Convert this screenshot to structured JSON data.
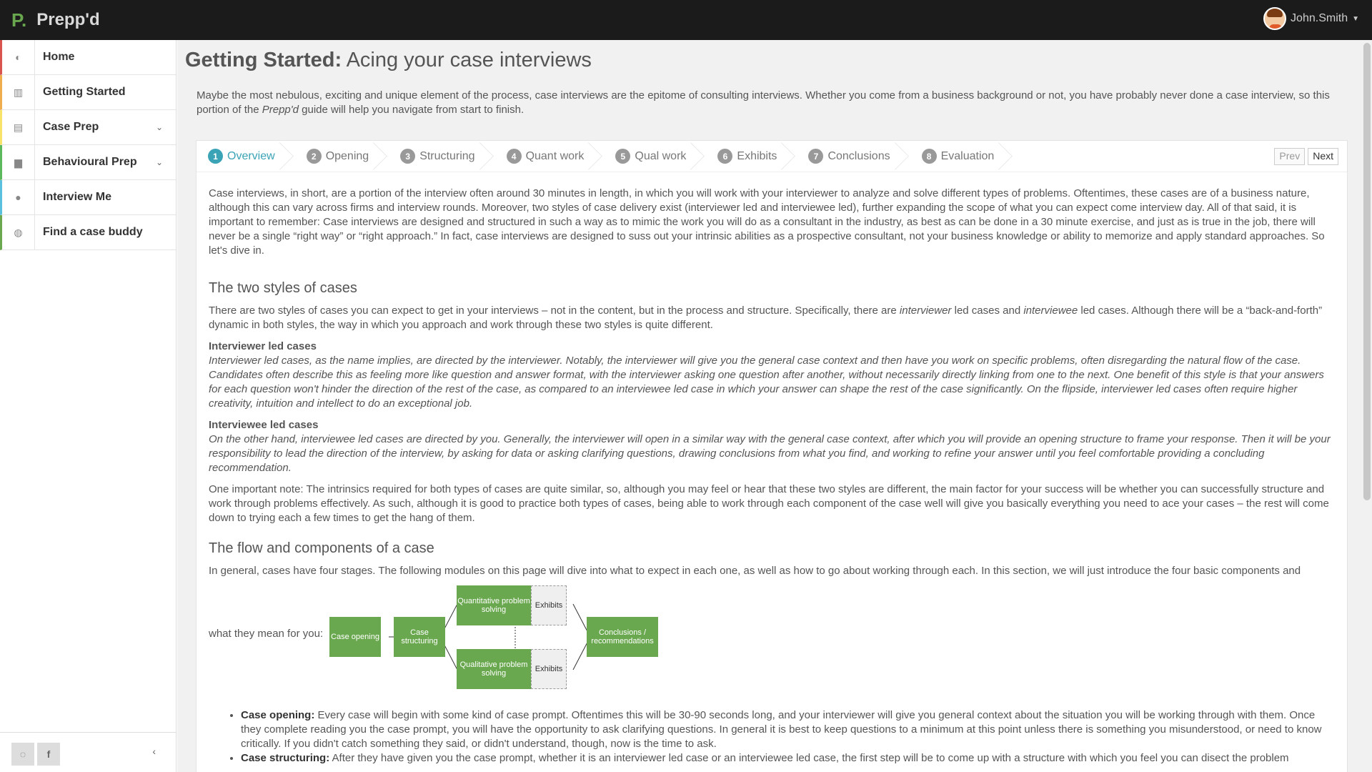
{
  "header": {
    "logo_mark": "P.",
    "app_name": "Prepp'd",
    "username": "John.Smith"
  },
  "sidebar": {
    "items": [
      {
        "label": "Home",
        "icon": "dashboard-icon"
      },
      {
        "label": "Getting Started",
        "icon": "book-open-icon"
      },
      {
        "label": "Case Prep",
        "icon": "book-icon"
      },
      {
        "label": "Behavioural Prep",
        "icon": "file-icon"
      },
      {
        "label": "Interview Me",
        "icon": "user-icon"
      },
      {
        "label": "Find a case buddy",
        "icon": "globe-icon"
      }
    ]
  },
  "page": {
    "title_bold": "Getting Started:",
    "title_rest": " Acing your case interviews",
    "intro_a": "Maybe the most nebulous, exciting and unique element of the process, case interviews are the epitome of consulting interviews. Whether you come from a business background or not, you have probably never done a case interview, so this portion of the ",
    "intro_em": "Prepp'd",
    "intro_b": " guide will help you navigate from start to finish."
  },
  "tabs": [
    {
      "num": "1",
      "label": "Overview"
    },
    {
      "num": "2",
      "label": "Opening"
    },
    {
      "num": "3",
      "label": "Structuring"
    },
    {
      "num": "4",
      "label": "Quant work"
    },
    {
      "num": "5",
      "label": "Qual work"
    },
    {
      "num": "6",
      "label": "Exhibits"
    },
    {
      "num": "7",
      "label": "Conclusions"
    },
    {
      "num": "8",
      "label": "Evaluation"
    }
  ],
  "pager": {
    "prev": "Prev",
    "next": "Next"
  },
  "content": {
    "p1": "Case interviews, in short, are a portion of the interview often around 30 minutes in length, in which you will work with your interviewer to analyze and solve different types of problems. Oftentimes, these cases are of a business nature, although this can vary across firms and interview rounds. Moreover, two styles of case delivery exist (interviewer led and interviewee led), further expanding the scope of what you can expect come interview day. All of that said, it is important to remember: Case interviews are designed and structured in such a way as to mimic the work you will do as a consultant in the industry, as best as can be done in a 30 minute exercise, and just as is true in the job, there will never be a single “right way” or “right approach.” In fact, case interviews are designed to suss out your intrinsic abilities as a prospective consultant, not your business knowledge or ability to memorize and apply standard approaches. So let's dive in.",
    "h_styles": "The two styles of cases",
    "p2a": "There are two styles of cases you can expect to get in your interviews – not in the content, but in the process and structure. Specifically, there are ",
    "p2_em1": "interviewer",
    "p2b": " led cases and ",
    "p2_em2": "interviewee",
    "p2c": " led cases. Although there will be a “back-and-forth” dynamic in both styles, the way in which you approach and work through these two styles is quite different.",
    "h_interviewer": "Interviewer led cases",
    "p_interviewer": "Interviewer led cases, as the name implies, are directed by the interviewer. Notably, the interviewer will give you the general case context and then have you work on specific problems, often disregarding the natural flow of the case. Candidates often describe this as feeling more like question and answer format, with the interviewer asking one question after another, without necessarily directly linking from one to the next. One benefit of this style is that your answers for each question won't hinder the direction of the rest of the case, as compared to an interviewee led case in which your answer can shape the rest of the case significantly. On the flipside, interviewer led cases often require higher creativity, intuition and intellect to do an exceptional job.",
    "h_interviewee": "Interviewee led cases",
    "p_interviewee": "On the other hand, interviewee led cases are directed by you. Generally, the interviewer will open in a similar way with the general case context, after which you will provide an opening structure to frame your response. Then it will be your responsibility to lead the direction of the interview, by asking for data or asking clarifying questions, drawing conclusions from what you find, and working to refine your answer until you feel comfortable providing a concluding recommendation.",
    "p_note": "One important note: The intrinsics required for both types of cases are quite similar, so, although you may feel or hear that these two styles are different, the main factor for your success will be whether you can successfully structure and work through problems effectively. As such, although it is good to practice both types of cases, being able to work through each component of the case well will give you basically everything you need to ace your cases – the rest will come down to trying each a few times to get the hang of them.",
    "h_flow": "The flow and components of a case",
    "p_flow": "In general, cases have four stages. The following modules on this page will dive into what to expect in each one, as well as how to go about working through each. In this section, we will just introduce the four basic components and",
    "flow_lead": "what they mean for you:",
    "bullet1_b": "Case opening:",
    "bullet1": " Every case will begin with some kind of case prompt. Oftentimes this will be 30-90 seconds long, and your interviewer will give you general context about the situation you will be working through with them. Once they complete reading you the case prompt, you will have the opportunity to ask clarifying questions. In general it is best to keep questions to a minimum at this point unless there is something you misunderstood, or need to know critically. If you didn't catch something they said, or didn't understand, though, now is the time to ask.",
    "bullet2_b": "Case structuring:",
    "bullet2": " After they have given you the case prompt, whether it is an interviewer led case or an interviewee led case, the first step will be to come up with a structure with which you feel you can disect the problem"
  },
  "diagram": {
    "opening": "Case opening",
    "structuring": "Case structuring",
    "quant": "Quantitative problem solving",
    "qual": "Qualitative problem solving",
    "exhibits1": "Exhibits",
    "exhibits2": "Exhibits",
    "conclusions": "Conclusions / recommendations"
  },
  "colors": {
    "accent": "#3aa3b5",
    "green": "#6aa84f",
    "topbar": "#1b1b1b"
  }
}
